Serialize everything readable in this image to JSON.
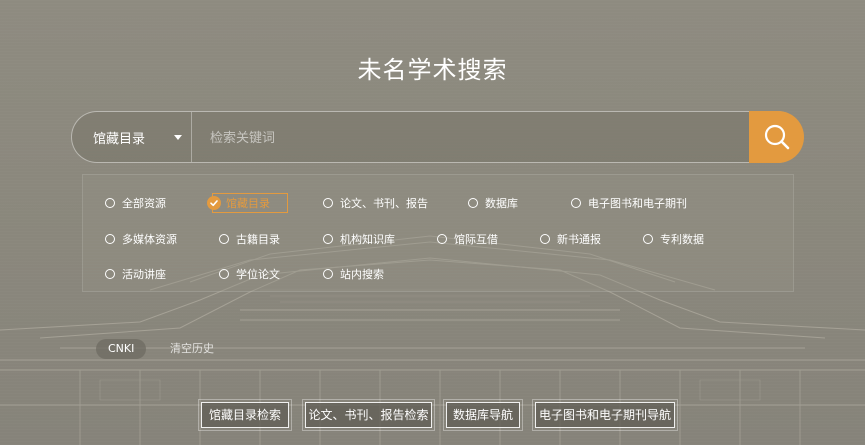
{
  "title": "未名学术搜索",
  "search": {
    "select_label": "馆藏目录",
    "placeholder": "检索关键词",
    "value": ""
  },
  "options": {
    "row1": [
      "全部资源",
      "馆藏目录",
      "论文、书刊、报告",
      "数据库",
      "电子图书和电子期刊"
    ],
    "row2": [
      "多媒体资源",
      "古籍目录",
      "机构知识库",
      "馆际互借",
      "新书通报",
      "专利数据"
    ],
    "row3": [
      "活动讲座",
      "学位论文",
      "站内搜索"
    ],
    "selected": "馆藏目录"
  },
  "history": {
    "chip": "CNKI",
    "clear_label": "清空历史"
  },
  "quick_links": [
    "馆藏目录检索",
    "论文、书刊、报告检索",
    "数据库导航",
    "电子图书和电子期刊导航"
  ],
  "colors": {
    "accent": "#e39a3f",
    "background": "#8a877b"
  },
  "icons": {
    "search_button": "search-icon",
    "dropdown": "caret-down-icon",
    "selected_option": "check-icon"
  }
}
